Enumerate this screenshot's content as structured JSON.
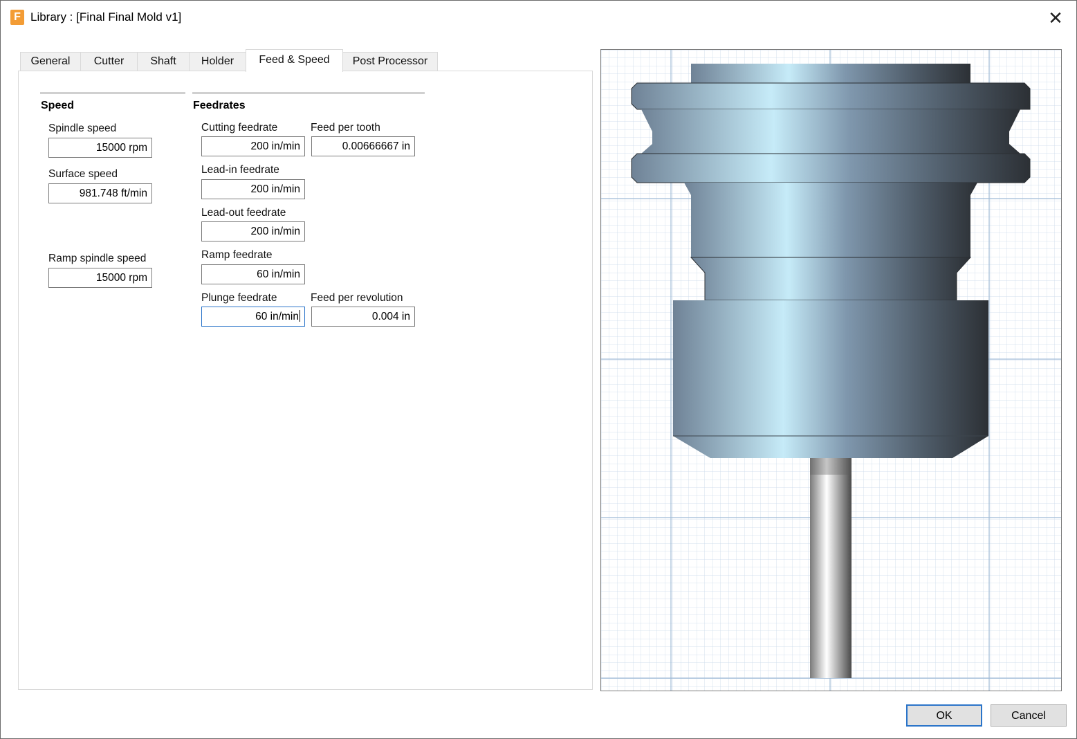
{
  "window": {
    "title": "Library : [Final Final Mold v1]",
    "app_icon_letter": "F",
    "close_glyph": "✕",
    "icon_names": {
      "app": "fusion-app-icon",
      "close": "close-icon"
    },
    "accent_color": "#2a74c9"
  },
  "tabs": [
    {
      "label": "General",
      "active": false
    },
    {
      "label": "Cutter",
      "active": false
    },
    {
      "label": "Shaft",
      "active": false
    },
    {
      "label": "Holder",
      "active": false
    },
    {
      "label": "Feed & Speed",
      "active": true
    },
    {
      "label": "Post Processor",
      "active": false
    }
  ],
  "speed": {
    "title": "Speed",
    "spindle_speed": {
      "label": "Spindle speed",
      "value": "15000 rpm"
    },
    "surface_speed": {
      "label": "Surface speed",
      "value": "981.748 ft/min"
    },
    "ramp_spindle_speed": {
      "label": "Ramp spindle speed",
      "value": "15000 rpm"
    }
  },
  "feedrates": {
    "title": "Feedrates",
    "cutting": {
      "label": "Cutting feedrate",
      "value": "200 in/min"
    },
    "feed_per_tooth": {
      "label": "Feed per tooth",
      "value": "0.00666667 in"
    },
    "lead_in": {
      "label": "Lead-in feedrate",
      "value": "200 in/min"
    },
    "lead_out": {
      "label": "Lead-out feedrate",
      "value": "200 in/min"
    },
    "ramp": {
      "label": "Ramp feedrate",
      "value": "60 in/min"
    },
    "plunge": {
      "label": "Plunge feedrate",
      "value": "60 in/min"
    },
    "feed_per_revolution": {
      "label": "Feed per revolution",
      "value": "0.004 in"
    }
  },
  "buttons": {
    "ok": "OK",
    "cancel": "Cancel"
  }
}
